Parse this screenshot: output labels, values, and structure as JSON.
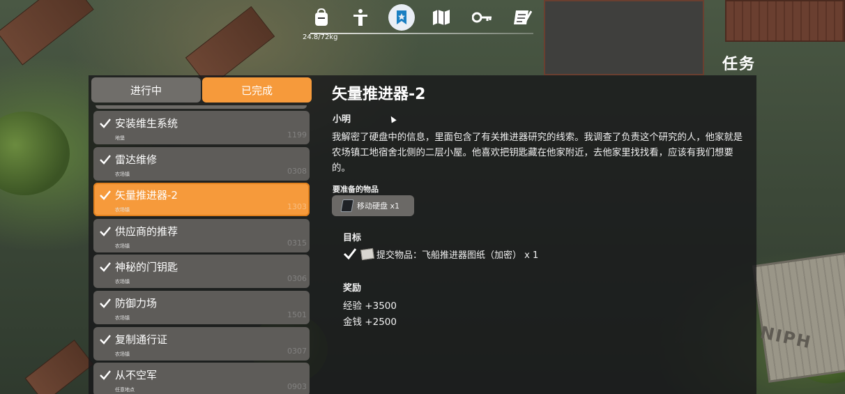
{
  "hud": {
    "weight": "24.8/72kg",
    "nav_icons": [
      "backpack-icon",
      "character-icon",
      "quest-icon",
      "map-icon",
      "key-icon",
      "notes-icon"
    ],
    "active_nav": "quest-icon"
  },
  "page_title": "任务",
  "tabs": {
    "in_progress": "进行中",
    "completed": "已完成",
    "active": "completed"
  },
  "quests": [
    {
      "title": "安装维生系统",
      "location": "地堡",
      "number": "1199"
    },
    {
      "title": "雷达维修",
      "location": "农场镇",
      "number": "0308"
    },
    {
      "title": "矢量推进器-2",
      "location": "农场镇",
      "number": "1303",
      "selected": true
    },
    {
      "title": "供应商的推荐",
      "location": "农场镇",
      "number": "0315"
    },
    {
      "title": "神秘的门钥匙",
      "location": "农场镇",
      "number": "0306"
    },
    {
      "title": "防御力场",
      "location": "农场镇",
      "number": "1501"
    },
    {
      "title": "复制通行证",
      "location": "农场镇",
      "number": "0307"
    },
    {
      "title": "从不空军",
      "location": "任意地点",
      "number": "0903"
    }
  ],
  "detail": {
    "title": "矢量推进器-2",
    "speaker": "小明",
    "description": "我解密了硬盘中的信息，里面包含了有关推进器研究的线索。我调查了负责这个研究的人，他家就是农场镇工地宿舍北侧的二层小屋。他喜欢把钥匙藏在他家附近，去他家里找找看，应该有我们想要的。",
    "required_label": "要准备的物品",
    "required_item": "移动硬盘 x1",
    "goal_label": "目标",
    "goal_text": "提交物品：飞船推进器图纸（加密） x 1",
    "reward_label": "奖励",
    "rewards": [
      "经验 +3500",
      "金钱 +2500"
    ]
  },
  "colors": {
    "accent": "#f69a3b",
    "tab_inactive": "#706e6a",
    "item_bg": "#5e5c59"
  }
}
